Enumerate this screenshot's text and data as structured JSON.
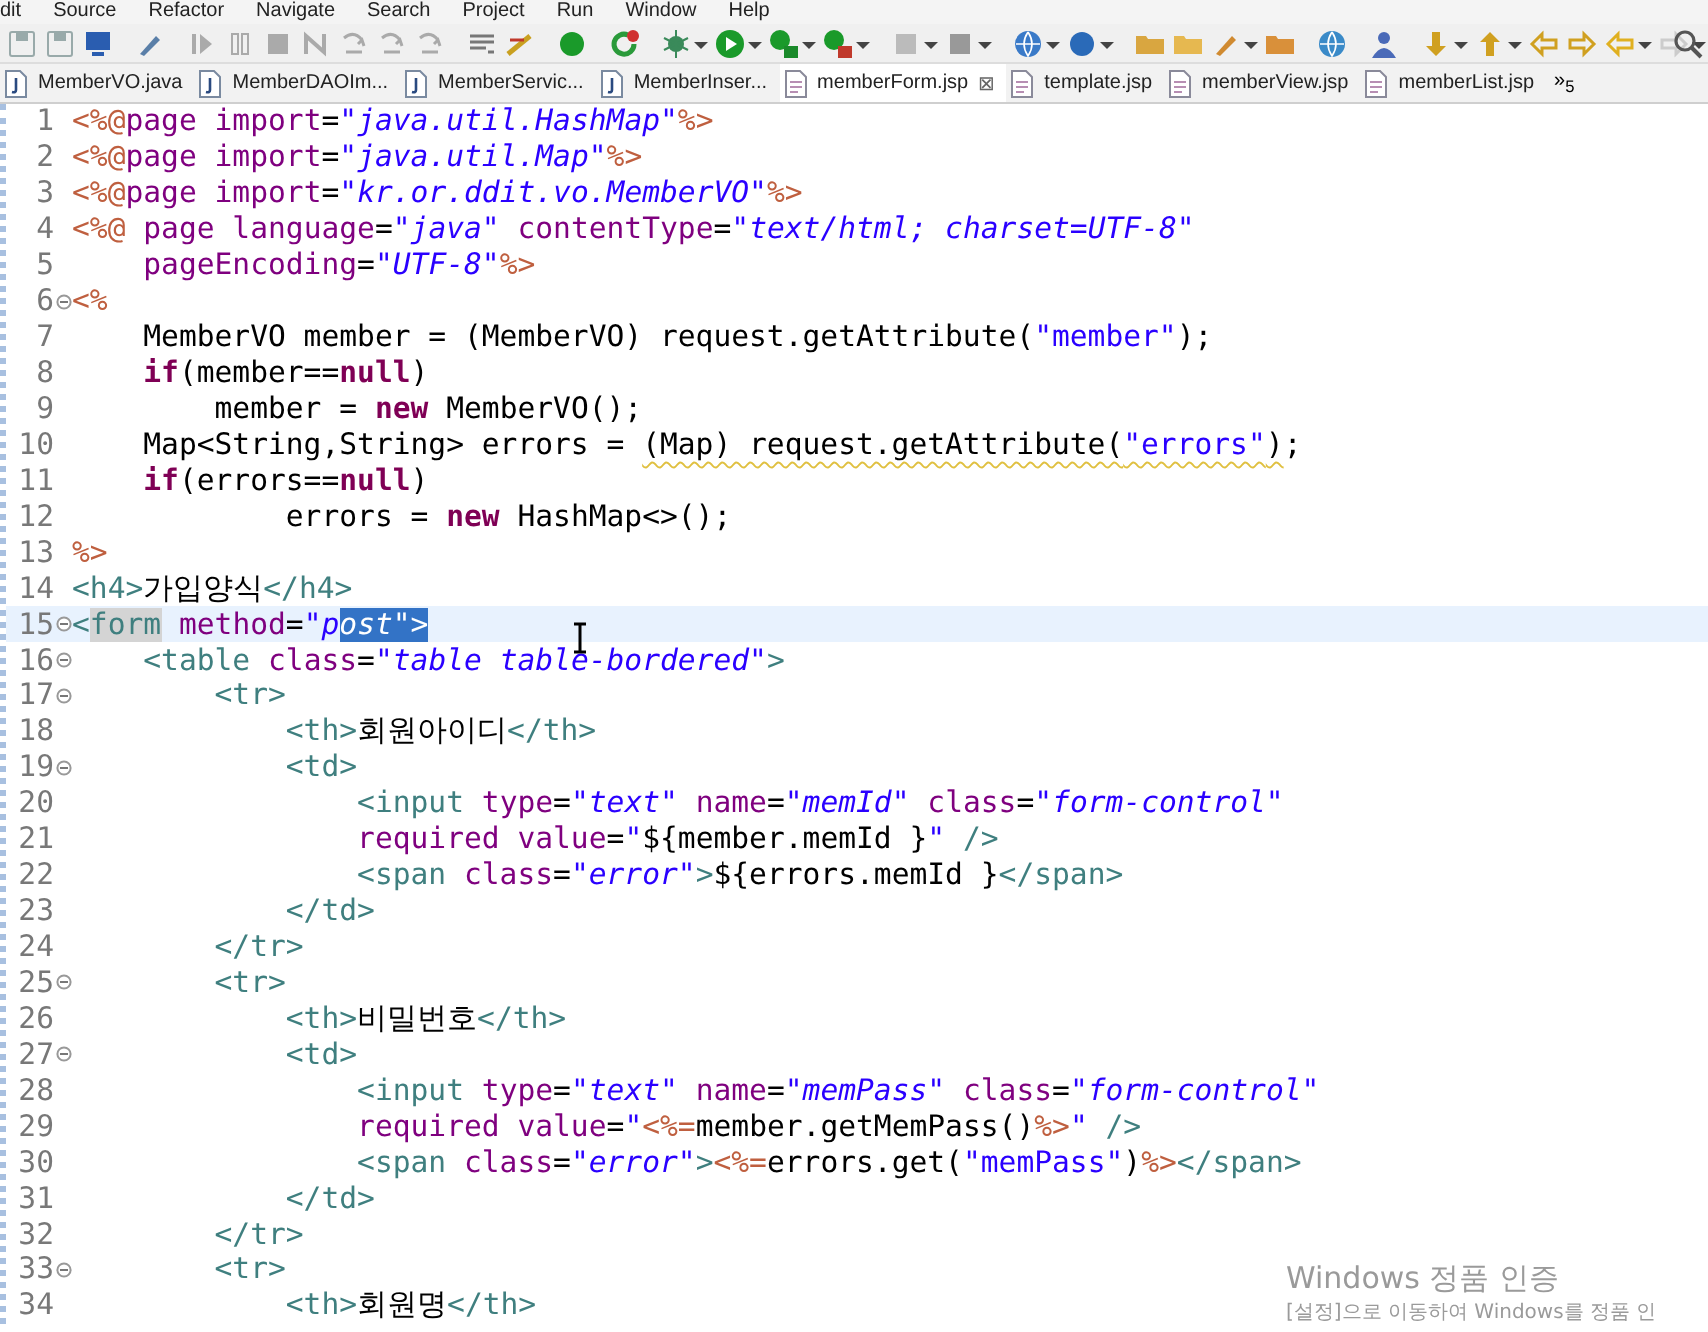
{
  "menu": [
    "dit",
    "Source",
    "Refactor",
    "Navigate",
    "Search",
    "Project",
    "Run",
    "Window",
    "Help"
  ],
  "tabs": [
    {
      "label": "MemberVO.java",
      "kind": "java",
      "selected": false
    },
    {
      "label": "MemberDAOIm...",
      "kind": "java",
      "selected": false
    },
    {
      "label": "MemberServic...",
      "kind": "java",
      "selected": false
    },
    {
      "label": "MemberInser...",
      "kind": "java",
      "selected": false
    },
    {
      "label": "memberForm.jsp",
      "kind": "jsp",
      "selected": true,
      "close": "⊠"
    },
    {
      "label": "template.jsp",
      "kind": "jsp",
      "selected": false
    },
    {
      "label": "memberView.jsp",
      "kind": "jsp",
      "selected": false
    },
    {
      "label": "memberList.jsp",
      "kind": "jsp",
      "selected": false
    }
  ],
  "tab_overflow": "»$_{5}$",
  "lines": [
    {
      "number": "1",
      "fold": false,
      "current": false,
      "tokens": [
        {
          "kind": "jsp",
          "text": "<%@"
        },
        {
          "kind": "attr",
          "text": "page import"
        },
        {
          "kind": "plain",
          "text": "="
        },
        {
          "kind": "val",
          "text": "\"java.util.HashMap\""
        },
        {
          "kind": "jsp",
          "text": "%>"
        }
      ]
    },
    {
      "number": "2",
      "fold": false,
      "current": false,
      "tokens": [
        {
          "kind": "jsp",
          "text": "<%@"
        },
        {
          "kind": "attr",
          "text": "page import"
        },
        {
          "kind": "plain",
          "text": "="
        },
        {
          "kind": "val",
          "text": "\"java.util.Map\""
        },
        {
          "kind": "jsp",
          "text": "%>"
        }
      ]
    },
    {
      "number": "3",
      "fold": false,
      "current": false,
      "tokens": [
        {
          "kind": "jsp",
          "text": "<%@"
        },
        {
          "kind": "attr",
          "text": "page import"
        },
        {
          "kind": "plain",
          "text": "="
        },
        {
          "kind": "val",
          "text": "\"kr.or.ddit.vo.MemberVO\""
        },
        {
          "kind": "jsp",
          "text": "%>"
        }
      ]
    },
    {
      "number": "4",
      "fold": false,
      "current": false,
      "tokens": [
        {
          "kind": "jsp",
          "text": "<%@"
        },
        {
          "kind": "attr",
          "text": " page language"
        },
        {
          "kind": "plain",
          "text": "="
        },
        {
          "kind": "val",
          "text": "\"java\""
        },
        {
          "kind": "attr",
          "text": " contentType"
        },
        {
          "kind": "plain",
          "text": "="
        },
        {
          "kind": "val",
          "text": "\"text/html; charset=UTF-8\""
        }
      ]
    },
    {
      "number": "5",
      "fold": false,
      "current": false,
      "tokens": [
        {
          "kind": "attr",
          "text": "    pageEncoding"
        },
        {
          "kind": "plain",
          "text": "="
        },
        {
          "kind": "val",
          "text": "\"UTF-8\""
        },
        {
          "kind": "jsp",
          "text": "%>"
        }
      ]
    },
    {
      "number": "6",
      "fold": true,
      "current": false,
      "tokens": [
        {
          "kind": "jsp",
          "text": "<%"
        }
      ]
    },
    {
      "number": "7",
      "fold": false,
      "current": false,
      "tokens": [
        {
          "kind": "plain",
          "text": "    MemberVO member = (MemberVO) request.getAttribute("
        },
        {
          "kind": "str",
          "text": "\"member\""
        },
        {
          "kind": "plain",
          "text": ");"
        }
      ]
    },
    {
      "number": "8",
      "fold": false,
      "current": false,
      "tokens": [
        {
          "kind": "kw",
          "text": "    if"
        },
        {
          "kind": "plain",
          "text": "(member=="
        },
        {
          "kind": "kw",
          "text": "null"
        },
        {
          "kind": "plain",
          "text": ")"
        }
      ]
    },
    {
      "number": "9",
      "fold": false,
      "current": false,
      "tokens": [
        {
          "kind": "plain",
          "text": "        member = "
        },
        {
          "kind": "kw",
          "text": "new"
        },
        {
          "kind": "plain",
          "text": " MemberVO();"
        }
      ]
    },
    {
      "number": "10",
      "fold": false,
      "current": false,
      "tokens": [
        {
          "kind": "plain",
          "text": "    Map<String,String> errors = "
        },
        {
          "kind": "plain",
          "text": "(Map) request.getAttribute(",
          "warning": true
        },
        {
          "kind": "str",
          "text": "\"errors\"",
          "warning": true
        },
        {
          "kind": "plain",
          "text": ")",
          "warning": true
        },
        {
          "kind": "plain",
          "text": ";"
        }
      ]
    },
    {
      "number": "11",
      "fold": false,
      "current": false,
      "tokens": [
        {
          "kind": "kw",
          "text": "    if"
        },
        {
          "kind": "plain",
          "text": "(errors=="
        },
        {
          "kind": "kw",
          "text": "null"
        },
        {
          "kind": "plain",
          "text": ")"
        }
      ]
    },
    {
      "number": "12",
      "fold": false,
      "current": false,
      "tokens": [
        {
          "kind": "plain",
          "text": "            errors = "
        },
        {
          "kind": "kw",
          "text": "new"
        },
        {
          "kind": "plain",
          "text": " HashMap<>();"
        }
      ]
    },
    {
      "number": "13",
      "fold": false,
      "current": false,
      "tokens": [
        {
          "kind": "jsp",
          "text": "%>"
        }
      ]
    },
    {
      "number": "14",
      "fold": false,
      "current": false,
      "tokens": [
        {
          "kind": "tag",
          "text": "<h4>"
        },
        {
          "kind": "plain",
          "text": "가입양식"
        },
        {
          "kind": "tag",
          "text": "</h4>"
        }
      ]
    },
    {
      "number": "15",
      "fold": true,
      "current": true,
      "tokens": [
        {
          "kind": "tag",
          "text": "<"
        },
        {
          "kind": "mark",
          "text": "form"
        },
        {
          "kind": "attr",
          "text": " method"
        },
        {
          "kind": "plain",
          "text": "="
        },
        {
          "kind": "val",
          "text": "\"p"
        },
        {
          "kind": "sel",
          "text": "ost\">"
        }
      ]
    },
    {
      "number": "16",
      "fold": true,
      "current": false,
      "tokens": [
        {
          "kind": "tag",
          "text": "    <table"
        },
        {
          "kind": "attr",
          "text": " class"
        },
        {
          "kind": "plain",
          "text": "="
        },
        {
          "kind": "val",
          "text": "\"table table-bordered\""
        },
        {
          "kind": "tag",
          "text": ">"
        }
      ]
    },
    {
      "number": "17",
      "fold": true,
      "current": false,
      "tokens": [
        {
          "kind": "tag",
          "text": "        <tr>"
        }
      ]
    },
    {
      "number": "18",
      "fold": false,
      "current": false,
      "tokens": [
        {
          "kind": "tag",
          "text": "            <th>"
        },
        {
          "kind": "plain",
          "text": "회원아이디"
        },
        {
          "kind": "tag",
          "text": "</th>"
        }
      ]
    },
    {
      "number": "19",
      "fold": true,
      "current": false,
      "tokens": [
        {
          "kind": "tag",
          "text": "            <td>"
        }
      ]
    },
    {
      "number": "20",
      "fold": false,
      "current": false,
      "tokens": [
        {
          "kind": "tag",
          "text": "                <input"
        },
        {
          "kind": "attr",
          "text": " type"
        },
        {
          "kind": "plain",
          "text": "="
        },
        {
          "kind": "val",
          "text": "\"text\""
        },
        {
          "kind": "attr",
          "text": " name"
        },
        {
          "kind": "plain",
          "text": "="
        },
        {
          "kind": "val",
          "text": "\"memId\""
        },
        {
          "kind": "attr",
          "text": " class"
        },
        {
          "kind": "plain",
          "text": "="
        },
        {
          "kind": "val",
          "text": "\"form-control\""
        }
      ]
    },
    {
      "number": "21",
      "fold": false,
      "current": false,
      "tokens": [
        {
          "kind": "attr",
          "text": "                required value"
        },
        {
          "kind": "plain",
          "text": "="
        },
        {
          "kind": "val",
          "text": "\""
        },
        {
          "kind": "plain",
          "text": "${member.memId }"
        },
        {
          "kind": "val",
          "text": "\""
        },
        {
          "kind": "tag",
          "text": " />"
        }
      ]
    },
    {
      "number": "22",
      "fold": false,
      "current": false,
      "tokens": [
        {
          "kind": "tag",
          "text": "                <span"
        },
        {
          "kind": "attr",
          "text": " class"
        },
        {
          "kind": "plain",
          "text": "="
        },
        {
          "kind": "val",
          "text": "\"error\""
        },
        {
          "kind": "tag",
          "text": ">"
        },
        {
          "kind": "plain",
          "text": "${errors.memId }"
        },
        {
          "kind": "tag",
          "text": "</span>"
        }
      ]
    },
    {
      "number": "23",
      "fold": false,
      "current": false,
      "tokens": [
        {
          "kind": "tag",
          "text": "            </td>"
        }
      ]
    },
    {
      "number": "24",
      "fold": false,
      "current": false,
      "tokens": [
        {
          "kind": "tag",
          "text": "        </tr>"
        }
      ]
    },
    {
      "number": "25",
      "fold": true,
      "current": false,
      "tokens": [
        {
          "kind": "tag",
          "text": "        <tr>"
        }
      ]
    },
    {
      "number": "26",
      "fold": false,
      "current": false,
      "tokens": [
        {
          "kind": "tag",
          "text": "            <th>"
        },
        {
          "kind": "plain",
          "text": "비밀번호"
        },
        {
          "kind": "tag",
          "text": "</th>"
        }
      ]
    },
    {
      "number": "27",
      "fold": true,
      "current": false,
      "tokens": [
        {
          "kind": "tag",
          "text": "            <td>"
        }
      ]
    },
    {
      "number": "28",
      "fold": false,
      "current": false,
      "tokens": [
        {
          "kind": "tag",
          "text": "                <input"
        },
        {
          "kind": "attr",
          "text": " type"
        },
        {
          "kind": "plain",
          "text": "="
        },
        {
          "kind": "val",
          "text": "\"text\""
        },
        {
          "kind": "attr",
          "text": " name"
        },
        {
          "kind": "plain",
          "text": "="
        },
        {
          "kind": "val",
          "text": "\"memPass\""
        },
        {
          "kind": "attr",
          "text": " class"
        },
        {
          "kind": "plain",
          "text": "="
        },
        {
          "kind": "val",
          "text": "\"form-control\""
        }
      ]
    },
    {
      "number": "29",
      "fold": false,
      "current": false,
      "tokens": [
        {
          "kind": "attr",
          "text": "                required value"
        },
        {
          "kind": "plain",
          "text": "="
        },
        {
          "kind": "val",
          "text": "\""
        },
        {
          "kind": "jsp",
          "text": "<%="
        },
        {
          "kind": "plain",
          "text": "member.getMemPass()"
        },
        {
          "kind": "jsp",
          "text": "%>"
        },
        {
          "kind": "val",
          "text": "\""
        },
        {
          "kind": "tag",
          "text": " />"
        }
      ]
    },
    {
      "number": "30",
      "fold": false,
      "current": false,
      "tokens": [
        {
          "kind": "tag",
          "text": "                <span"
        },
        {
          "kind": "attr",
          "text": " class"
        },
        {
          "kind": "plain",
          "text": "="
        },
        {
          "kind": "val",
          "text": "\"error\""
        },
        {
          "kind": "tag",
          "text": ">"
        },
        {
          "kind": "jsp",
          "text": "<%="
        },
        {
          "kind": "plain",
          "text": "errors.get("
        },
        {
          "kind": "str",
          "text": "\"memPass\""
        },
        {
          "kind": "plain",
          "text": ")"
        },
        {
          "kind": "jsp",
          "text": "%>"
        },
        {
          "kind": "tag",
          "text": "</span>"
        }
      ]
    },
    {
      "number": "31",
      "fold": false,
      "current": false,
      "tokens": [
        {
          "kind": "tag",
          "text": "            </td>"
        }
      ]
    },
    {
      "number": "32",
      "fold": false,
      "current": false,
      "tokens": [
        {
          "kind": "tag",
          "text": "        </tr>"
        }
      ]
    },
    {
      "number": "33",
      "fold": true,
      "current": false,
      "tokens": [
        {
          "kind": "tag",
          "text": "        <tr>"
        }
      ]
    },
    {
      "number": "34",
      "fold": false,
      "current": false,
      "tokens": [
        {
          "kind": "tag",
          "text": "            <th>"
        },
        {
          "kind": "plain",
          "text": "회원명"
        },
        {
          "kind": "tag",
          "text": "</th>"
        }
      ]
    }
  ],
  "activation_notice": {
    "title": "Windows 정품 인증",
    "message": "[설정]으로 이동하여 Windows를 정품 인"
  }
}
